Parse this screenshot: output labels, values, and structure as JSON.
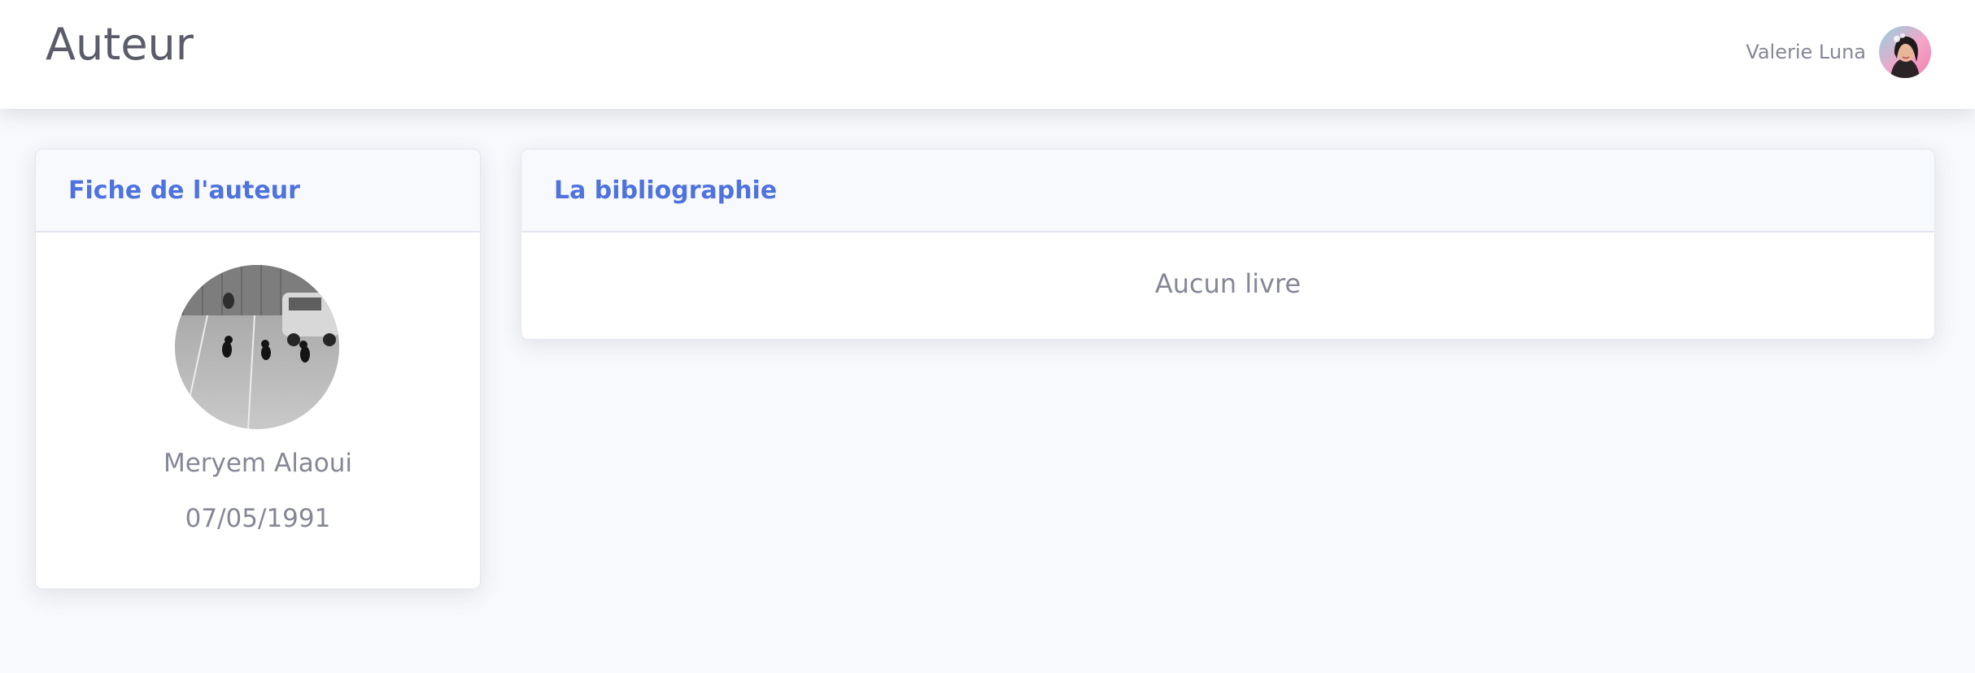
{
  "header": {
    "title": "Auteur",
    "user_name": "Valerie Luna",
    "avatar_icon": "user-avatar-image"
  },
  "author_card": {
    "title": "Fiche de l'auteur",
    "photo_icon": "author-photo-image",
    "name": "Meryem Alaoui",
    "birth_date": "07/05/1991"
  },
  "bibliography_card": {
    "title": "La bibliographie",
    "empty_message": "Aucun livre"
  },
  "colors": {
    "accent": "#4e73df",
    "text_muted": "#858796",
    "title_text": "#5a5c69",
    "page_background": "#f8f9fc",
    "card_border": "#e3e6f0"
  }
}
